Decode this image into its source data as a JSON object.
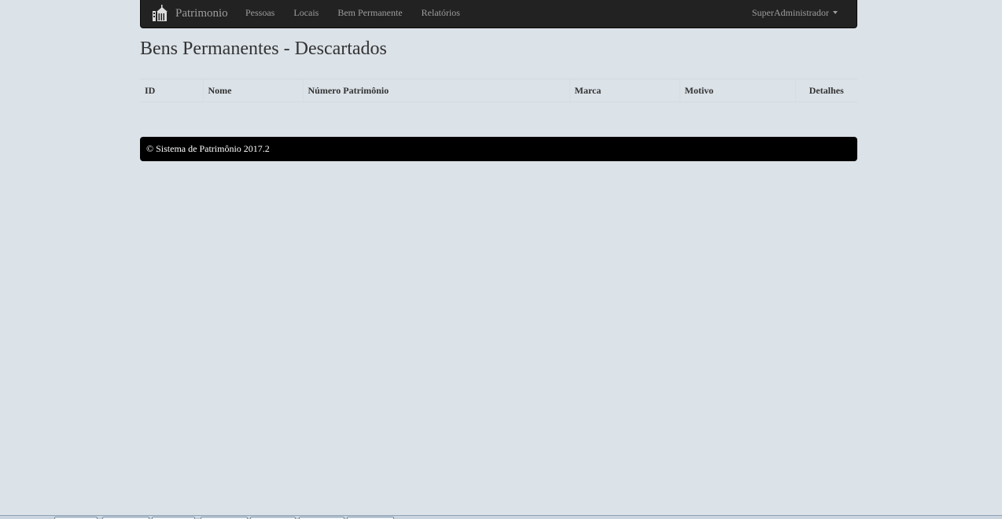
{
  "navbar": {
    "brand": "Patrimonio",
    "links": [
      "Pessoas",
      "Locais",
      "Bem Permanente",
      "Relatórios"
    ],
    "user": "SuperAdministrador"
  },
  "main": {
    "title": "Bens Permanentes - Descartados",
    "table": {
      "headers": [
        "ID",
        "Nome",
        "Número Patrimônio",
        "Marca",
        "Motivo",
        "Detalhes"
      ],
      "rows": []
    }
  },
  "footer": {
    "text": "© Sistema de Patrimônio 2017.2"
  },
  "colors": {
    "navbar_bg": "#222222",
    "page_bg": "#dbe2e8",
    "footer_bg": "#000000",
    "nav_text": "#9d9d9d"
  }
}
